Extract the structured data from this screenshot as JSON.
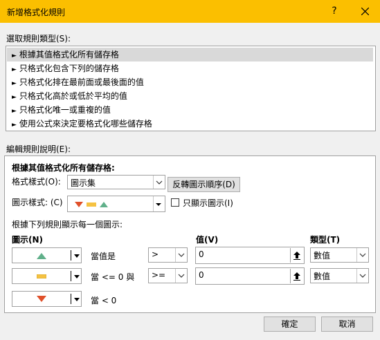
{
  "window": {
    "title": "新增格式化規則",
    "help_label": "?",
    "close_label": "✕"
  },
  "rule_type": {
    "label": "選取規則類型(S):",
    "items": [
      "根據其值格式化所有儲存格",
      "只格式化包含下列的儲存格",
      "只格式化排在最前面或最後面的值",
      "只格式化高於或低於平均的值",
      "只格式化唯一或重複的值",
      "使用公式來決定要格式化哪些儲存格"
    ],
    "selected_index": 0
  },
  "edit": {
    "label": "編輯規則說明(E):",
    "heading": "根據其值格式化所有儲存格:",
    "format_style_label": "格式樣式(O):",
    "format_style_value": "圖示集",
    "reverse_button": "反轉圖示順序(D)",
    "icon_style_label": "圖示樣式: (C)",
    "show_icon_only_label": "只顯示圖示(I)",
    "show_icon_only_checked": false,
    "rules_label": "根據下列規則顯示每一個圖示:",
    "col_icon": "圖示(N)",
    "col_value": "值(V)",
    "col_type": "類型(T)",
    "rows": [
      {
        "icon": "green-triangle-up-icon",
        "condition": "當值是",
        "operator": ">",
        "value": "0",
        "type": "數值"
      },
      {
        "icon": "yellow-dash-icon",
        "condition": "當 <= 0 與",
        "operator": ">=",
        "value": "0",
        "type": "數值"
      },
      {
        "icon": "red-triangle-down-icon",
        "condition": "當 < 0"
      }
    ]
  },
  "footer": {
    "ok": "確定",
    "cancel": "取消"
  },
  "colors": {
    "title_bar": "#fbbf00",
    "up": "#60b08a",
    "mid": "#f5c242",
    "down": "#e0502a"
  }
}
